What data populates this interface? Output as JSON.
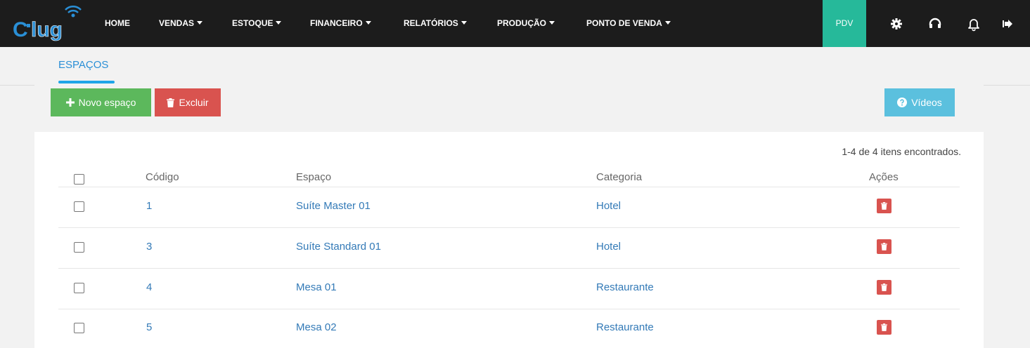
{
  "brand": {
    "logo_text": "CPlug"
  },
  "nav": {
    "items": [
      {
        "label": "HOME",
        "dropdown": false
      },
      {
        "label": "VENDAS",
        "dropdown": true
      },
      {
        "label": "ESTOQUE",
        "dropdown": true
      },
      {
        "label": "FINANCEIRO",
        "dropdown": true
      },
      {
        "label": "RELATÓRIOS",
        "dropdown": true
      },
      {
        "label": "PRODUÇÃO",
        "dropdown": true
      },
      {
        "label": "PONTO DE VENDA",
        "dropdown": true
      }
    ],
    "pdv_label": "PDV",
    "icons": [
      "gear-icon",
      "headset-icon",
      "bell-icon",
      "logout-icon"
    ]
  },
  "page": {
    "breadcrumb": "ESPAÇOS",
    "buttons": {
      "new_label": "Novo espaço",
      "delete_label": "Excluir",
      "videos_label": "Vídeos"
    },
    "results_count": "1-4 de 4 itens encontrados."
  },
  "table": {
    "headers": {
      "code": "Código",
      "space": "Espaço",
      "category": "Categoria",
      "actions": "Ações"
    },
    "rows": [
      {
        "code": "1",
        "space": "Suíte Master 01",
        "category": "Hotel"
      },
      {
        "code": "3",
        "space": "Suíte Standard 01",
        "category": "Hotel"
      },
      {
        "code": "4",
        "space": "Mesa 01",
        "category": "Restaurante"
      },
      {
        "code": "5",
        "space": "Mesa 02",
        "category": "Restaurante"
      }
    ]
  },
  "colors": {
    "topbar": "#1c1c1c",
    "pdv": "#26b99a",
    "success": "#5cb85c",
    "danger": "#d9534f",
    "info": "#5bc0de",
    "link": "#337ab7"
  }
}
